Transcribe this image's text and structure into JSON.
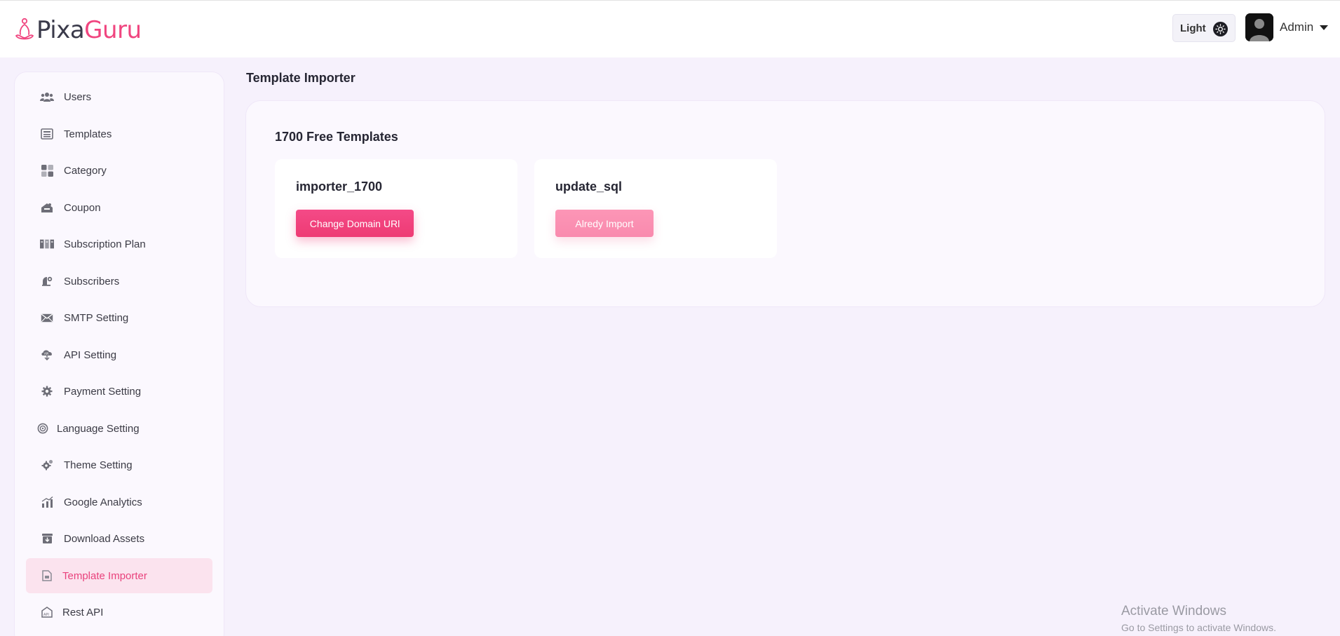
{
  "brand": {
    "name_part1": "Pixa",
    "name_part2": "Guru",
    "accent": "#f0457f"
  },
  "header": {
    "theme_label": "Light",
    "theme_icon": "sun-icon",
    "user_name": "Admin",
    "user_icon": "user-avatar-icon"
  },
  "sidebar": {
    "items": [
      {
        "label": "Users",
        "icon": "users-icon"
      },
      {
        "label": "Templates",
        "icon": "templates-icon"
      },
      {
        "label": "Category",
        "icon": "category-grid-icon"
      },
      {
        "label": "Coupon",
        "icon": "coupon-icon"
      },
      {
        "label": "Subscription Plan",
        "icon": "subscription-plan-icon"
      },
      {
        "label": "Subscribers",
        "icon": "subscribers-icon"
      },
      {
        "label": "SMTP Setting",
        "icon": "envelope-icon"
      },
      {
        "label": "API Setting",
        "icon": "api-icon"
      },
      {
        "label": "Payment Setting",
        "icon": "payment-gear-icon"
      },
      {
        "label": "Language Setting",
        "icon": "language-icon"
      },
      {
        "label": "Theme Setting",
        "icon": "theme-gear-icon"
      },
      {
        "label": "Google Analytics",
        "icon": "analytics-chart-icon"
      },
      {
        "label": "Download Assets",
        "icon": "download-assets-icon"
      },
      {
        "label": "Template Importer",
        "icon": "template-importer-icon",
        "active": true
      },
      {
        "label": "Rest API",
        "icon": "rest-api-icon"
      }
    ]
  },
  "main": {
    "page_title": "Template Importer",
    "section_title": "1700 Free Templates",
    "cards": [
      {
        "title": "importer_1700",
        "button_label": "Change Domain URl",
        "button_state": "enabled"
      },
      {
        "title": "update_sql",
        "button_label": "Alredy Import",
        "button_state": "disabled"
      }
    ]
  },
  "watermark": {
    "title": "Activate Windows",
    "subtitle": "Go to Settings to activate Windows."
  }
}
